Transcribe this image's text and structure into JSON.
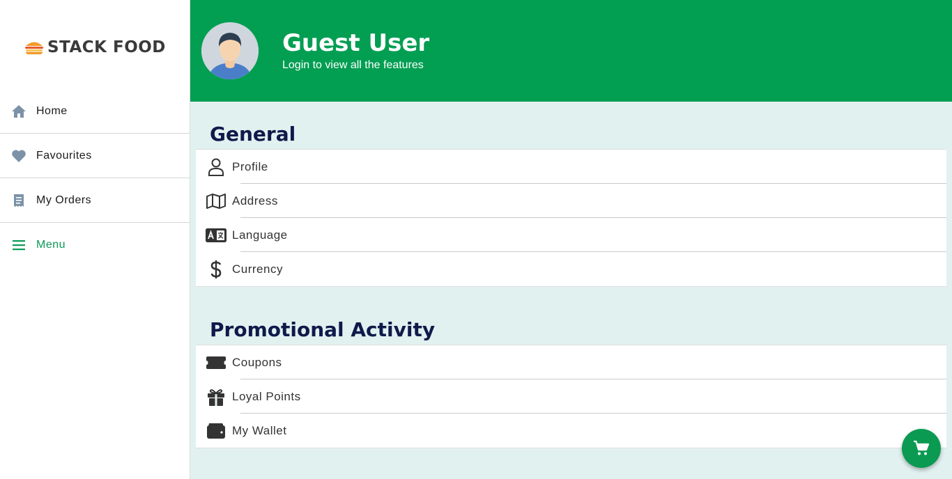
{
  "app": {
    "logo_text": "STACK FOOD"
  },
  "sidebar": {
    "items": [
      {
        "label": "Home",
        "icon": "home-icon"
      },
      {
        "label": "Favourites",
        "icon": "heart-icon"
      },
      {
        "label": "My Orders",
        "icon": "receipt-icon"
      },
      {
        "label": "Menu",
        "icon": "menu-icon",
        "active": true
      }
    ]
  },
  "header": {
    "name": "Guest User",
    "subtitle": "Login to view all the features"
  },
  "general": {
    "title": "General",
    "items": [
      {
        "label": "Profile",
        "icon": "person-icon"
      },
      {
        "label": "Address",
        "icon": "map-icon"
      },
      {
        "label": "Language",
        "icon": "translate-icon"
      },
      {
        "label": "Currency",
        "icon": "dollar-icon"
      }
    ]
  },
  "promo": {
    "title": "Promotional Activity",
    "items": [
      {
        "label": "Coupons",
        "icon": "ticket-icon"
      },
      {
        "label": "Loyal Points",
        "icon": "gift-icon"
      },
      {
        "label": "My Wallet",
        "icon": "wallet-icon"
      }
    ]
  },
  "colors": {
    "brand_green": "#029e52",
    "main_bg": "#e1f1f0",
    "heading": "#0f1a4a",
    "sidebar_icon": "#7c92a8"
  }
}
